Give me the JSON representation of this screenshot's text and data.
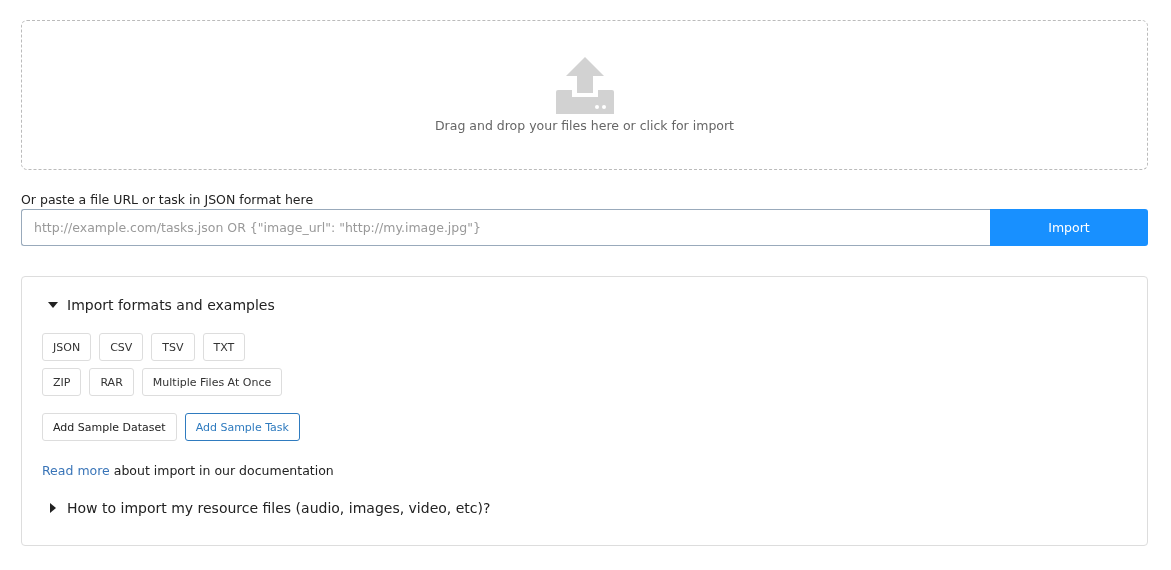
{
  "dropzone": {
    "text": "Drag and drop your files here or click for import"
  },
  "url_import": {
    "label": "Or paste a file URL or task in JSON format here",
    "placeholder": "http://example.com/tasks.json OR {\"image_url\": \"http://my.image.jpg\"}",
    "button": "Import"
  },
  "sections": [
    {
      "title": "Import formats and examples",
      "expanded": true,
      "format_rows": [
        [
          "JSON",
          "CSV",
          "TSV",
          "TXT"
        ],
        [
          "ZIP",
          "RAR",
          "Multiple Files At Once"
        ]
      ],
      "sample_buttons": [
        {
          "label": "Add Sample Dataset",
          "selected": false
        },
        {
          "label": "Add Sample Task",
          "selected": true
        }
      ],
      "note": {
        "link": "Read more",
        "text": "about import in our documentation"
      }
    },
    {
      "title": "How to import my resource files (audio, images, video, etc)?",
      "expanded": false
    }
  ]
}
